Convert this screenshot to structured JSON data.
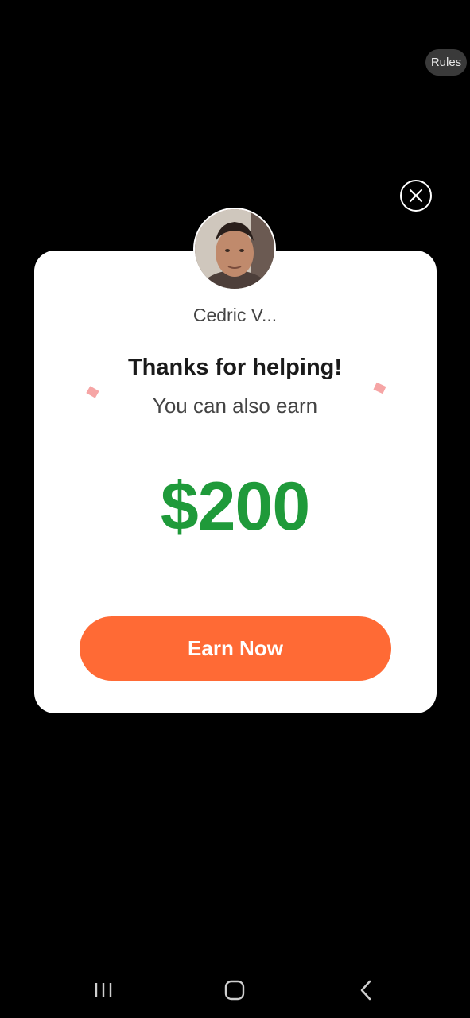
{
  "header": {
    "rules_label": "Rules"
  },
  "popup": {
    "username": "Cedric V...",
    "thanks_text": "Thanks for helping!",
    "subtitle": "You can also earn",
    "amount": "$200",
    "button_label": "Earn Now"
  },
  "icons": {
    "close": "close-icon",
    "avatar": "avatar-photo",
    "nav_recents": "recents-icon",
    "nav_home": "home-icon",
    "nav_back": "back-icon"
  },
  "colors": {
    "background": "#000000",
    "card": "#ffffff",
    "amount": "#1f9a3a",
    "button": "#ff6a35",
    "confetti": "#f6a5a5"
  }
}
